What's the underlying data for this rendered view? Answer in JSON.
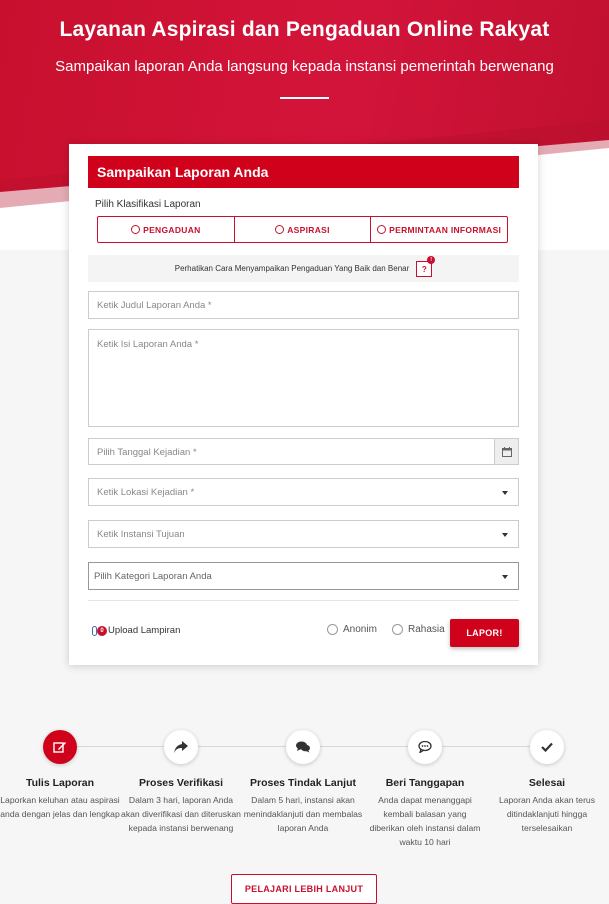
{
  "hero": {
    "title": "Layanan Aspirasi dan Pengaduan Online Rakyat",
    "subtitle": "Sampaikan laporan Anda langsung kepada instansi pemerintah berwenang"
  },
  "form": {
    "heading": "Sampaikan Laporan Anda",
    "classification_label": "Pilih Klasifikasi Laporan",
    "classifications": [
      "PENGADUAN",
      "ASPIRASI",
      "PERMINTAAN INFORMASI"
    ],
    "notice": "Perhatikan Cara Menyampaikan Pengaduan Yang Baik dan Benar",
    "help_button": "?",
    "help_badge": "!",
    "fields": {
      "title_placeholder": "Ketik Judul Laporan Anda *",
      "body_placeholder": "Ketik Isi Laporan Anda *",
      "date_placeholder": "Pilih Tanggal Kejadian *",
      "location_placeholder": "Ketik Lokasi Kejadian *",
      "agency_placeholder": "Ketik Instansi Tujuan",
      "category_placeholder": "Pilih Kategori Laporan Anda"
    },
    "upload_badge": "0",
    "upload_label": "Upload Lampiran",
    "anonymous_label": "Anonim",
    "secret_label": "Rahasia",
    "submit_label": "LAPOR!"
  },
  "steps": [
    {
      "icon": "edit-icon",
      "title": "Tulis Laporan",
      "desc": "Laporkan keluhan atau aspirasi anda dengan jelas dan lengkap",
      "active": true
    },
    {
      "icon": "share-icon",
      "title": "Proses Verifikasi",
      "desc": "Dalam 3 hari, laporan Anda akan diverifikasi dan diteruskan kepada instansi berwenang",
      "active": false
    },
    {
      "icon": "comments-icon",
      "title": "Proses Tindak Lanjut",
      "desc": "Dalam 5 hari, instansi akan menindaklanjuti dan membalas laporan Anda",
      "active": false
    },
    {
      "icon": "comment-icon",
      "title": "Beri Tanggapan",
      "desc": "Anda dapat menanggapi kembali balasan yang diberikan oleh instansi dalam waktu 10 hari",
      "active": false
    },
    {
      "icon": "check-icon",
      "title": "Selesai",
      "desc": "Laporan Anda akan terus ditindaklanjuti hingga terselesaikan",
      "active": false
    }
  ],
  "learn_more_label": "PELAJARI LEBIH LANJUT",
  "colors": {
    "brand": "#d0021b",
    "hero": "#c8102e"
  }
}
